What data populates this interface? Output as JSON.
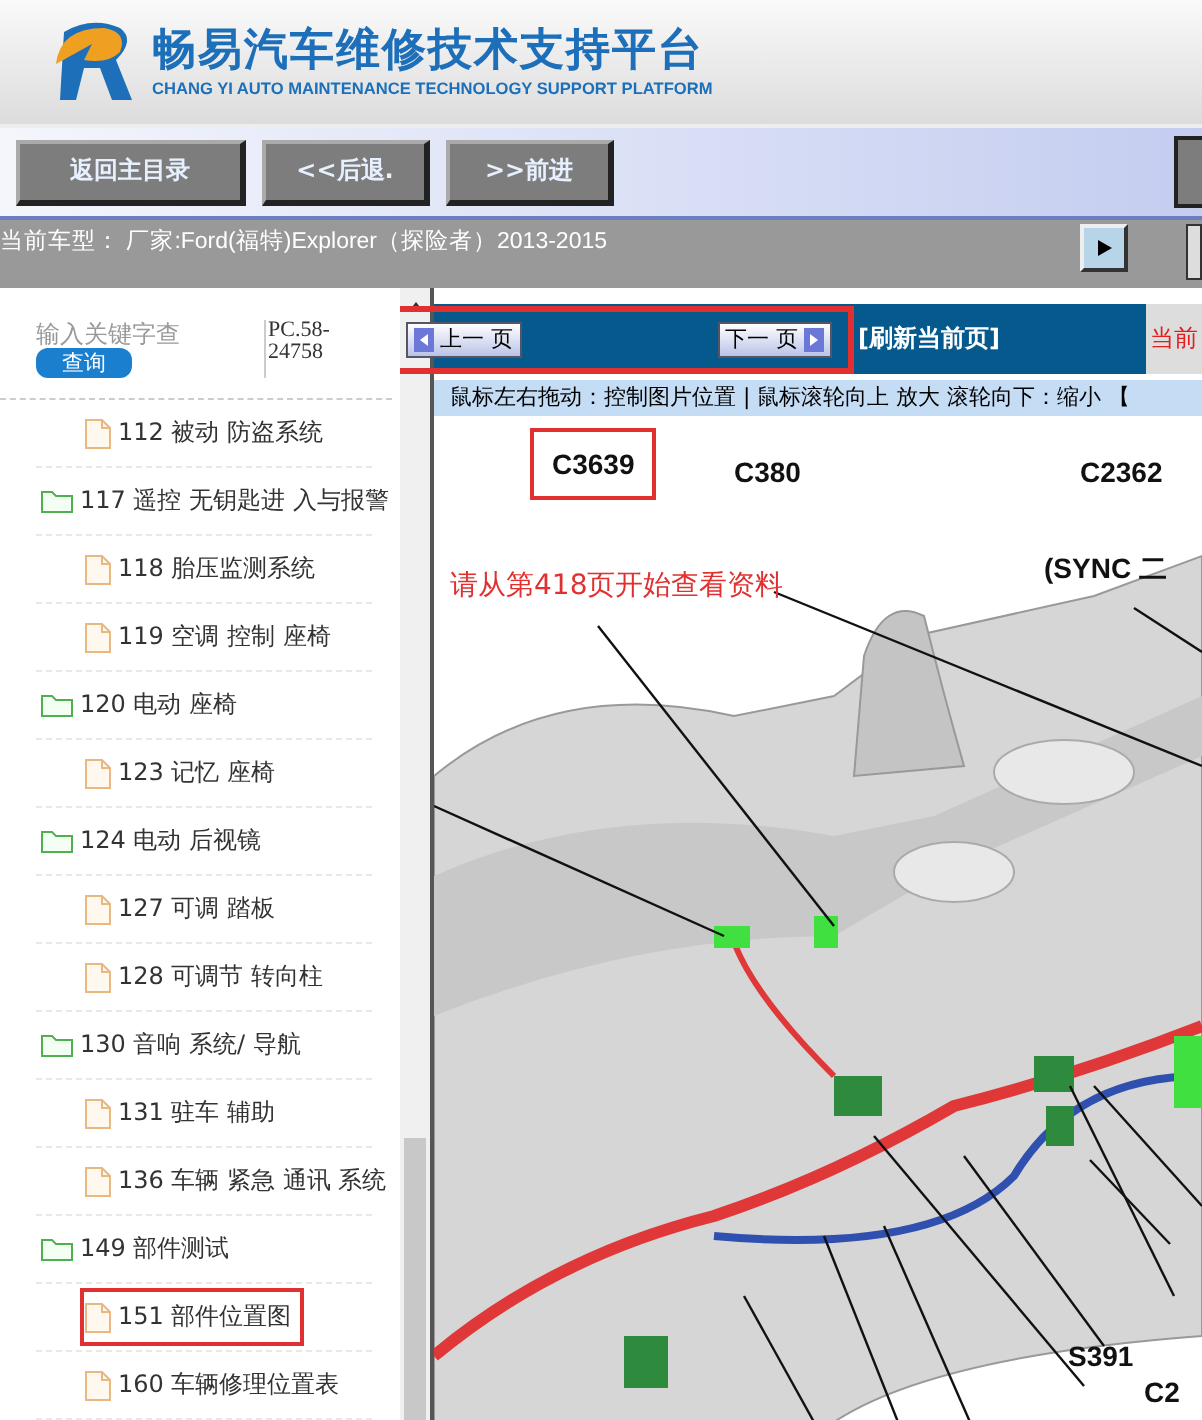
{
  "header": {
    "title": "畅易汽车维修技术支持平台",
    "subtitle": "CHANG YI AUTO MAINTENANCE TECHNOLOGY SUPPORT PLATFORM"
  },
  "toolbar": {
    "buttons": [
      "返回主目录",
      "<<后退.",
      ">>前进"
    ]
  },
  "vehicle": {
    "text": "当前车型： 厂家:Ford(福特)Explorer（探险者）2013-2015"
  },
  "search": {
    "placeholder": "输入关键字查",
    "button": "查询",
    "code": "PC.58-24758"
  },
  "tree": [
    {
      "label": "112 被动 防盗系统",
      "kind": "file",
      "selected": false
    },
    {
      "label": "117 遥控 无钥匙进 入与报警",
      "kind": "folder",
      "selected": false,
      "children": [
        {
          "label": "118 胎压监测系统",
          "kind": "file",
          "selected": false
        },
        {
          "label": "119 空调 控制 座椅",
          "kind": "file",
          "selected": false
        }
      ]
    },
    {
      "label": "120 电动 座椅",
      "kind": "folder",
      "selected": false,
      "children": [
        {
          "label": "123 记忆 座椅",
          "kind": "file",
          "selected": false
        }
      ]
    },
    {
      "label": "124 电动 后视镜",
      "kind": "folder",
      "selected": false,
      "children": [
        {
          "label": "127 可调 踏板",
          "kind": "file",
          "selected": false
        },
        {
          "label": "128 可调节 转向柱",
          "kind": "file",
          "selected": false
        }
      ]
    },
    {
      "label": "130 音响 系统/ 导航",
      "kind": "folder",
      "selected": false,
      "children": [
        {
          "label": "131 驻车 辅助",
          "kind": "file",
          "selected": false
        },
        {
          "label": "136 车辆 紧急 通讯 系统",
          "kind": "file",
          "selected": false
        }
      ]
    },
    {
      "label": "149 部件测试",
      "kind": "folder",
      "selected": false,
      "children": [
        {
          "label": "151 部件位置图",
          "kind": "file",
          "selected": true
        },
        {
          "label": "160 车辆修理位置表",
          "kind": "file",
          "selected": false
        }
      ]
    }
  ],
  "pager": {
    "prev": "上一 页",
    "next": "下一 页",
    "refresh": "[刷新当前页]",
    "current": "当前"
  },
  "hint": "鼠标左右拖动：控制图片位置 | 鼠标滚轮向上 放大  滚轮向下：缩小 【",
  "diagram": {
    "note": "请从第418页开始查看资料",
    "labels": [
      {
        "text": "C3639",
        "highlighted": true
      },
      {
        "text": "C380",
        "highlighted": false
      },
      {
        "text": "C2362",
        "highlighted": false
      },
      {
        "text": "(SYNC 二",
        "highlighted": false
      },
      {
        "text": "S391",
        "highlighted": false
      },
      {
        "text": "C2",
        "highlighted": false
      }
    ]
  }
}
